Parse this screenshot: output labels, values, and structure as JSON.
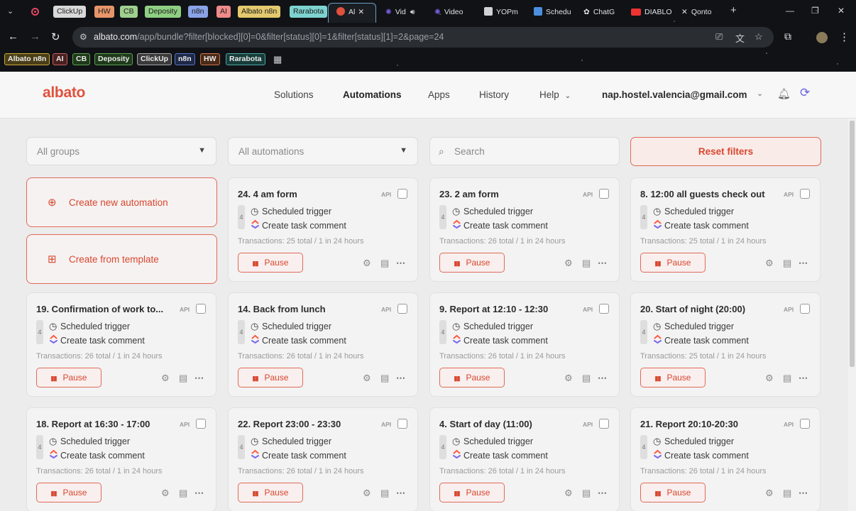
{
  "browser": {
    "pill_tabs": [
      {
        "label": "ClickUp",
        "color": "#d9d9d9"
      },
      {
        "label": "HW",
        "color": "#e8956a"
      },
      {
        "label": "CB",
        "color": "#9fd08e"
      },
      {
        "label": "Deposity",
        "color": "#8fcf82"
      },
      {
        "label": "n8n",
        "color": "#8aa2e6"
      },
      {
        "label": "AI",
        "color": "#ee8a8a"
      },
      {
        "label": "Albato n8n",
        "color": "#e4c96e"
      },
      {
        "label": "Rarabota",
        "color": "#7dd3cf"
      }
    ],
    "tabs": [
      {
        "label": "Al",
        "icon": "albato-favicon",
        "color": "#e1513d"
      },
      {
        "label": "Vid",
        "icon": "video-favicon",
        "color": "#7b5ce0"
      },
      {
        "label": "Video",
        "icon": "video-favicon",
        "color": "#7b5ce0"
      },
      {
        "label": "YOPm",
        "icon": "yopmail-favicon",
        "color": "#cfd3d8"
      },
      {
        "label": "Schedu",
        "icon": "chart-favicon",
        "color": "#4a8fe0"
      },
      {
        "label": "ChatG",
        "icon": "chatgpt-favicon",
        "color": "#cfd3d8"
      },
      {
        "label": "DIABLO",
        "icon": "youtube-favicon",
        "color": "#e33"
      },
      {
        "label": "Qonto",
        "icon": "qonto-favicon",
        "color": "#cfd3d8"
      }
    ],
    "url_host": "albato.com",
    "url_path": "/app/bundle?filter[blocked][0]=0&filter[status][0]=1&filter[status][1]=2&page=24",
    "bookmarks": [
      {
        "label": "Albato n8n",
        "color": "#c9a83a"
      },
      {
        "label": "AI",
        "color": "#c76060"
      },
      {
        "label": "CB",
        "color": "#5c9e4e"
      },
      {
        "label": "Deposity",
        "color": "#5e9e50"
      },
      {
        "label": "ClickUp",
        "color": "#a6a6a6"
      },
      {
        "label": "n8n",
        "color": "#5c74c4"
      },
      {
        "label": "HW",
        "color": "#c9764a"
      },
      {
        "label": "Rarabota",
        "color": "#4ea7a3"
      }
    ]
  },
  "header": {
    "logo": "albato",
    "nav": [
      "Solutions",
      "Automations",
      "Apps",
      "History",
      "Help"
    ],
    "active_nav": "Automations",
    "user_email": "nap.hostel.valencia@gmail.com"
  },
  "filters": {
    "groups_value": "All groups",
    "automations_value": "All automations",
    "search_placeholder": "Search",
    "reset_label": "Reset filters"
  },
  "create": {
    "new_label": "Create new automation",
    "template_label": "Create from template"
  },
  "card_common": {
    "api_label": "API",
    "step1": "Scheduled trigger",
    "step2": "Create task comment",
    "pause_label": "Pause",
    "steps_count": "4"
  },
  "cards": [
    {
      "title": "24. 4 am form",
      "transactions": "Transactions: 25 total / 1 in 24 hours"
    },
    {
      "title": "23. 2 am form",
      "transactions": "Transactions: 26 total / 1 in 24 hours"
    },
    {
      "title": "8. 12:00 all guests check out",
      "transactions": "Transactions: 25 total / 1 in 24 hours"
    },
    {
      "title": "19. Confirmation of work to...",
      "transactions": "Transactions: 26 total / 1 in 24 hours"
    },
    {
      "title": "14. Back from lunch",
      "transactions": "Transactions: 26 total / 1 in 24 hours"
    },
    {
      "title": "9. Report at 12:10 - 12:30",
      "transactions": "Transactions: 26 total / 1 in 24 hours"
    },
    {
      "title": "20. Start of night (20:00)",
      "transactions": "Transactions: 25 total / 1 in 24 hours"
    },
    {
      "title": "18. Report at 16:30 - 17:00",
      "transactions": "Transactions: 26 total / 1 in 24 hours"
    },
    {
      "title": "22. Report 23:00 - 23:30",
      "transactions": "Transactions: 26 total / 1 in 24 hours"
    },
    {
      "title": "4. Start of day (11:00)",
      "transactions": "Transactions: 26 total / 1 in 24 hours"
    },
    {
      "title": "21. Report 20:10-20:30",
      "transactions": "Transactions: 26 total / 1 in 24 hours"
    }
  ]
}
